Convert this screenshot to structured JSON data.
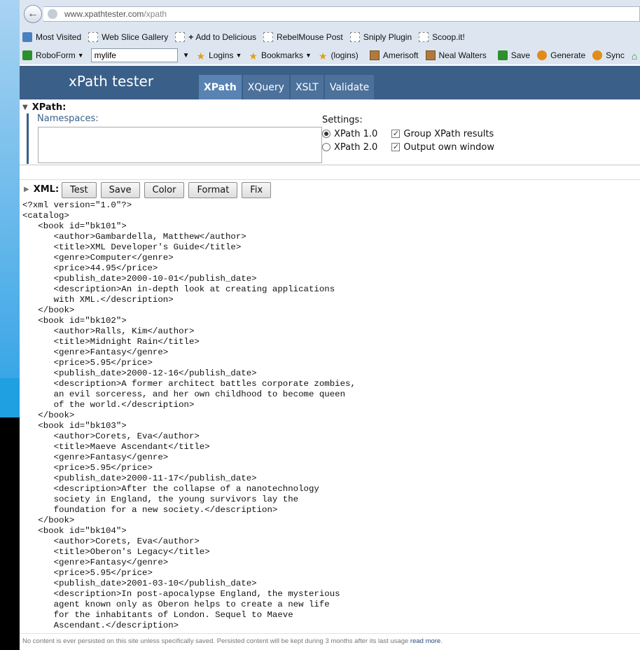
{
  "browser": {
    "url_host": "www.xpathtester.com",
    "url_path": "/xpath"
  },
  "bookmarks_bar": [
    {
      "label": "Most Visited",
      "icon": "page-icon"
    },
    {
      "label": "Web Slice Gallery",
      "icon": "page-icon"
    },
    {
      "label": "Add to Delicious",
      "icon": "plus-icon"
    },
    {
      "label": "RebelMouse Post",
      "icon": "page-icon"
    },
    {
      "label": "Sniply Plugin",
      "icon": "page-icon"
    },
    {
      "label": "Scoop.it!",
      "icon": "page-icon"
    }
  ],
  "roboform_bar": {
    "roboform_label": "RoboForm",
    "identity_value": "mylife",
    "logins_label": "Logins",
    "bookmarks_label": "Bookmarks",
    "logins_paren_label": "(logins)",
    "amerisoft_label": "Amerisoft",
    "neal_label": "Neal Walters",
    "save_label": "Save",
    "generate_label": "Generate",
    "sync_label": "Sync"
  },
  "app": {
    "title": "xPath tester",
    "tabs": [
      "XPath",
      "XQuery",
      "XSLT",
      "Validate"
    ],
    "active_tab": "XPath"
  },
  "xpath_panel": {
    "title": "XPath:",
    "namespaces_label": "Namespaces:",
    "settings_label": "Settings:",
    "version_options": [
      "XPath 1.0",
      "XPath 2.0"
    ],
    "selected_version": "XPath 1.0",
    "checkbox_options": [
      "Group XPath results",
      "Output own window"
    ],
    "checked": [
      true,
      true
    ]
  },
  "xml_panel": {
    "title": "XML:",
    "buttons": [
      "Test",
      "Save",
      "Color",
      "Format",
      "Fix"
    ],
    "content": "<?xml version=\"1.0\"?>\n<catalog>\n   <book id=\"bk101\">\n      <author>Gambardella, Matthew</author>\n      <title>XML Developer's Guide</title>\n      <genre>Computer</genre>\n      <price>44.95</price>\n      <publish_date>2000-10-01</publish_date>\n      <description>An in-depth look at creating applications\n      with XML.</description>\n   </book>\n   <book id=\"bk102\">\n      <author>Ralls, Kim</author>\n      <title>Midnight Rain</title>\n      <genre>Fantasy</genre>\n      <price>5.95</price>\n      <publish_date>2000-12-16</publish_date>\n      <description>A former architect battles corporate zombies,\n      an evil sorceress, and her own childhood to become queen\n      of the world.</description>\n   </book>\n   <book id=\"bk103\">\n      <author>Corets, Eva</author>\n      <title>Maeve Ascendant</title>\n      <genre>Fantasy</genre>\n      <price>5.95</price>\n      <publish_date>2000-11-17</publish_date>\n      <description>After the collapse of a nanotechnology\n      society in England, the young survivors lay the\n      foundation for a new society.</description>\n   </book>\n   <book id=\"bk104\">\n      <author>Corets, Eva</author>\n      <title>Oberon's Legacy</title>\n      <genre>Fantasy</genre>\n      <price>5.95</price>\n      <publish_date>2001-03-10</publish_date>\n      <description>In post-apocalypse England, the mysterious\n      agent known only as Oberon helps to create a new life\n      for the inhabitants of London. Sequel to Maeve\n      Ascendant.</description>"
  },
  "footer": {
    "text": "No content is ever persisted on this site unless specifically saved. Persisted content will be kept during 3 months after its last usage ",
    "link": "read more",
    "period": "."
  }
}
